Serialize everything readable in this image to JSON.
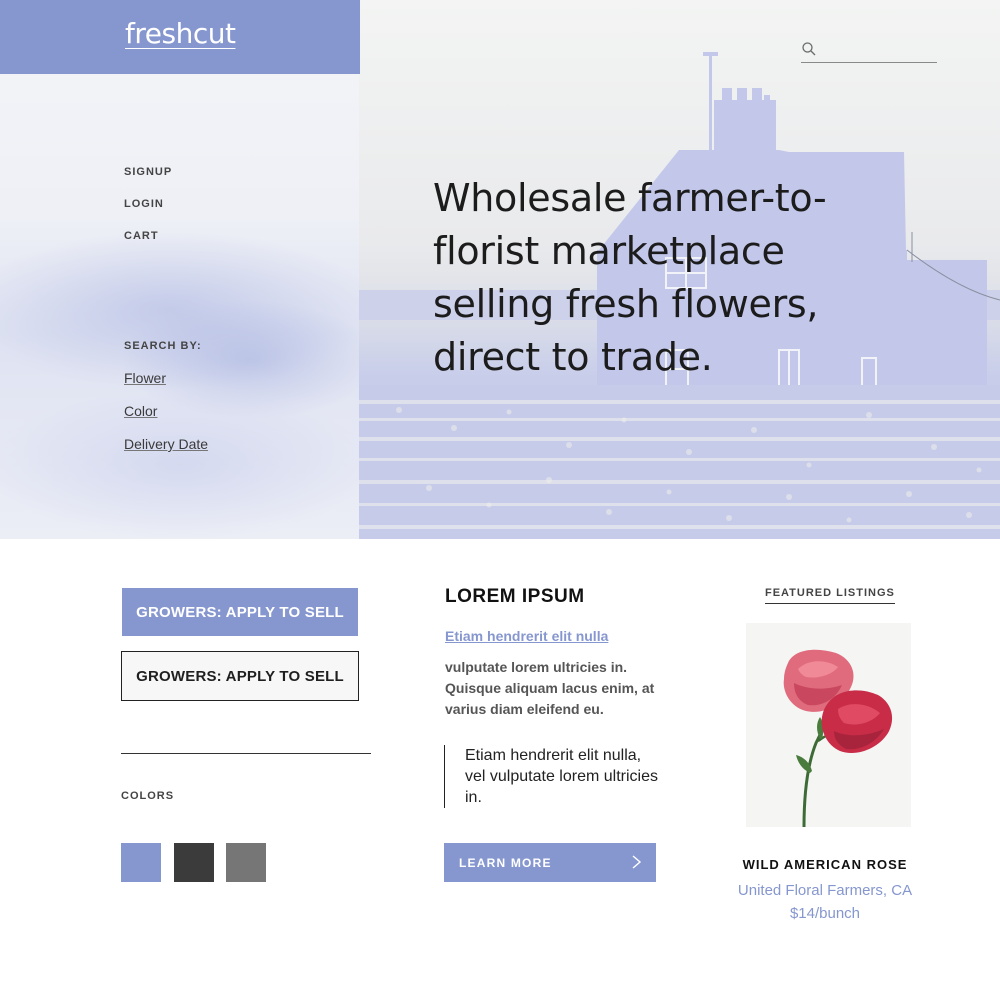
{
  "brand": {
    "logo": "freshcut"
  },
  "header": {
    "search": {
      "placeholder": ""
    }
  },
  "nav": {
    "items": [
      {
        "label": "SIGNUP"
      },
      {
        "label": "LOGIN"
      },
      {
        "label": "CART"
      }
    ]
  },
  "search_by": {
    "label": "SEARCH BY:",
    "items": [
      {
        "label": "Flower"
      },
      {
        "label": "Color"
      },
      {
        "label": "Delivery Date"
      }
    ]
  },
  "hero": {
    "headline": "Wholesale farmer-to-florist marketplace selling fresh flowers, direct to trade."
  },
  "buttons": {
    "primary_label": "GROWERS: APPLY TO SELL",
    "secondary_label": "GROWERS: APPLY TO SELL"
  },
  "colors": {
    "label": "COLORS",
    "swatches": [
      "#8697cf",
      "#3b3b3b",
      "#767676"
    ]
  },
  "article": {
    "title": "LOREM IPSUM",
    "link": "Etiam hendrerit elit nulla",
    "body": "vulputate lorem ultricies in. Quisque aliquam lacus enim, at varius diam eleifend eu.",
    "quote": "Etiam hendrerit elit nulla, vel vulputate lorem ultricies in.",
    "cta_label": "LEARN MORE",
    "cta_icon": "chevron-right-icon"
  },
  "featured": {
    "label": "FEATURED LISTINGS",
    "product": {
      "name": "WILD AMERICAN ROSE",
      "farm": "United Floral Farmers, CA",
      "price": "$14/bunch"
    }
  },
  "theme": {
    "accent": "#8697cf",
    "text": "#222222"
  }
}
